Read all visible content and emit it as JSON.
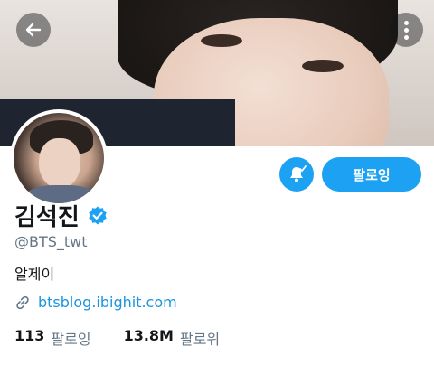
{
  "profile": {
    "name": "김석진",
    "handle": "@BTS_twt",
    "bio": "알제이",
    "link": "btsblog.ibighit.com",
    "follow_button_label": "팔로잉"
  },
  "stats": {
    "following_count": "113",
    "following_label": "팔로잉",
    "followers_count": "13.8M",
    "followers_label": "팔로워"
  },
  "icons": {
    "back": "arrow-left-icon",
    "more": "more-vertical-icon",
    "notify": "bell-check-icon",
    "verified": "verified-badge-icon",
    "link": "link-icon"
  },
  "colors": {
    "accent": "#1da1f2",
    "link": "#1b95e0",
    "secondary_text": "#657786"
  }
}
